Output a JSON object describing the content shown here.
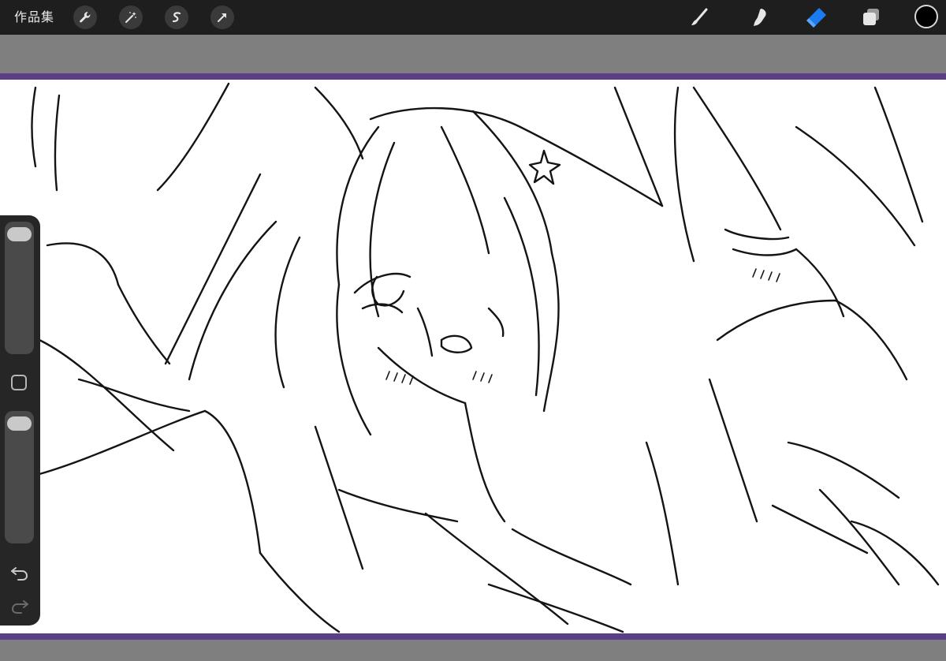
{
  "topbar": {
    "gallery_label": "作品集",
    "left_icons": [
      "wrench-icon",
      "magic-wand-icon",
      "selection-icon",
      "transform-arrow-icon"
    ],
    "right_tools": [
      "brush-icon",
      "smudge-icon",
      "eraser-icon",
      "layers-icon"
    ],
    "active_tool": "eraser",
    "current_color": "#000000"
  },
  "sidebar": {
    "brush_size_level": 0.03,
    "brush_opacity_level": 0.03
  },
  "colors": {
    "frame_accent": "#5b3f86",
    "active_tool_color": "#1a7cf0"
  }
}
